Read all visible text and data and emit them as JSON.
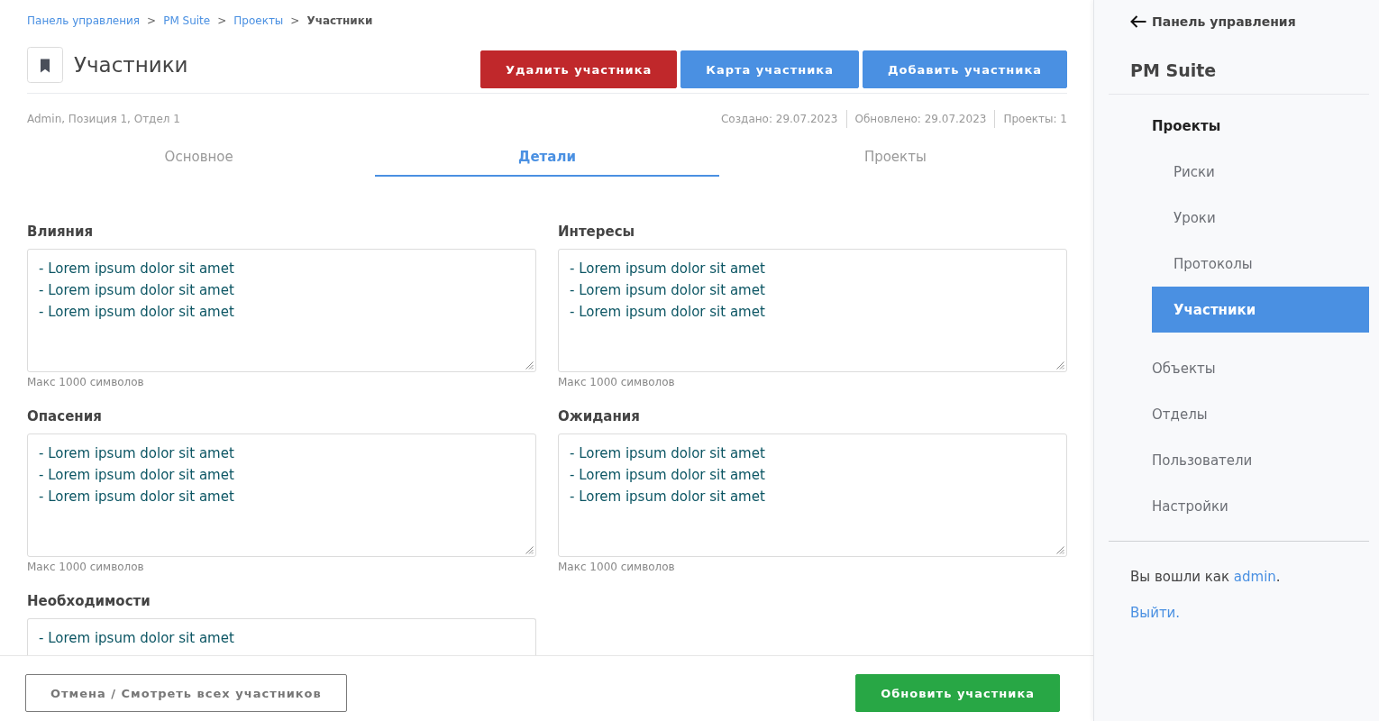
{
  "breadcrumb": {
    "separator": ">",
    "items": [
      {
        "label": "Панель управления",
        "current": false
      },
      {
        "label": "PM Suite",
        "current": false
      },
      {
        "label": "Проекты",
        "current": false
      },
      {
        "label": "Участники",
        "current": true
      }
    ]
  },
  "header": {
    "title": "Участники",
    "buttons": [
      {
        "label": "Удалить участника",
        "kind": "danger"
      },
      {
        "label": "Карта участника",
        "kind": "primary"
      },
      {
        "label": "Добавить участника",
        "kind": "primary"
      }
    ]
  },
  "meta": {
    "summary": "Admin, Позиция 1, Отдел 1",
    "stats": [
      "Создано: 29.07.2023",
      "Обновлено: 29.07.2023",
      "Проекты: 1"
    ]
  },
  "tabs": [
    {
      "label": "Основное",
      "selected": false
    },
    {
      "label": "Детали",
      "selected": true
    },
    {
      "label": "Проекты",
      "selected": false
    }
  ],
  "fields": [
    {
      "label": "Влияния",
      "lines": [
        "- Lorem ipsum dolor sit amet",
        "- Lorem ipsum dolor sit amet",
        "- Lorem ipsum dolor sit amet"
      ],
      "hint": "Макс 1000 символов"
    },
    {
      "label": "Интересы",
      "lines": [
        "- Lorem ipsum dolor sit amet",
        "- Lorem ipsum dolor sit amet",
        "- Lorem ipsum dolor sit amet"
      ],
      "hint": "Макс 1000 символов"
    },
    {
      "label": "Опасения",
      "lines": [
        "- Lorem ipsum dolor sit amet",
        "- Lorem ipsum dolor sit amet",
        "- Lorem ipsum dolor sit amet"
      ],
      "hint": "Макс 1000 символов"
    },
    {
      "label": "Ожидания",
      "lines": [
        "- Lorem ipsum dolor sit amet",
        "- Lorem ipsum dolor sit amet",
        "- Lorem ipsum dolor sit amet"
      ],
      "hint": "Макс 1000 символов"
    },
    {
      "label": "Необходимости",
      "lines": [
        "- Lorem ipsum dolor sit amet"
      ]
    }
  ],
  "footer": {
    "buttons": [
      {
        "label": "Отмена / Смотреть всех участников",
        "kind": "outline"
      },
      {
        "label": "Обновить участника",
        "kind": "success"
      }
    ]
  },
  "sidebar": {
    "back_link": "Панель управления",
    "title": "PM Suite",
    "nav": [
      {
        "label": "Проекты",
        "selected": false,
        "children": [
          {
            "label": "Риски",
            "selected": false
          },
          {
            "label": "Уроки",
            "selected": false
          },
          {
            "label": "Протоколы",
            "selected": false
          },
          {
            "label": "Участники",
            "selected": true
          }
        ]
      },
      {
        "label": "Объекты",
        "selected": false
      },
      {
        "label": "Отделы",
        "selected": false
      },
      {
        "label": "Пользователи",
        "selected": false
      },
      {
        "label": "Настройки",
        "selected": false
      }
    ],
    "session": {
      "text": "Вы вошли как",
      "user": "admin",
      "end": "."
    },
    "logout": "Выйти."
  }
}
